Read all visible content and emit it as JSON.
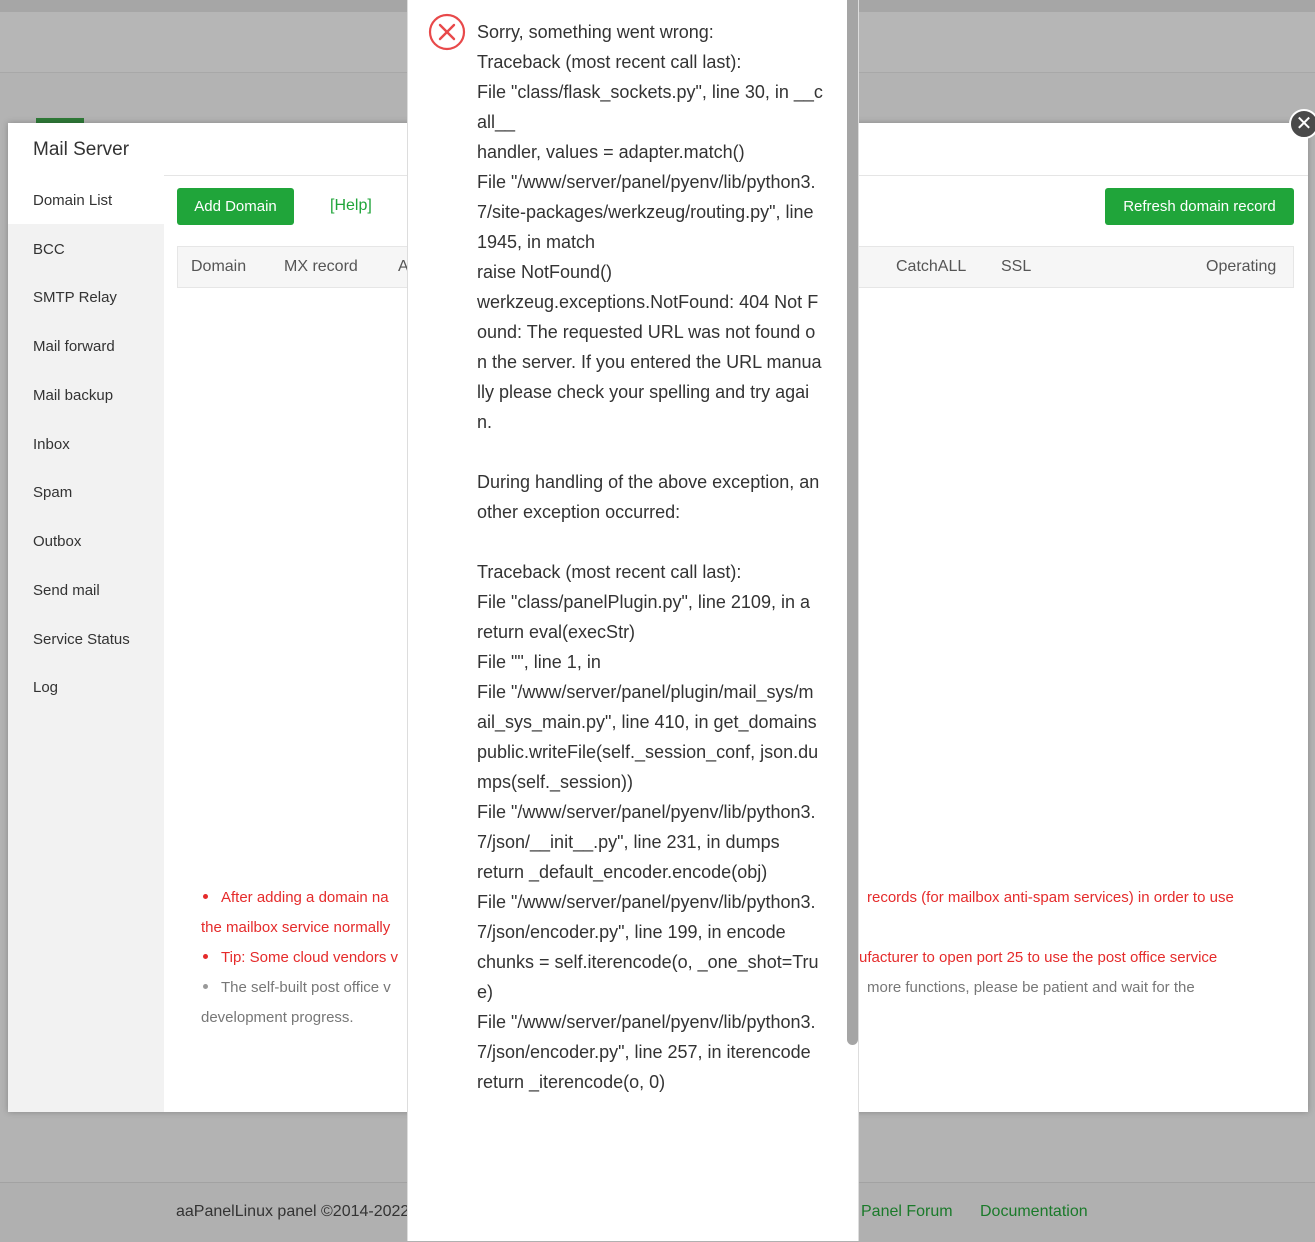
{
  "footer": {
    "copyright": "aaPanelLinux panel ©2014-2022",
    "links": [
      "Panel Forum",
      "Documentation"
    ]
  },
  "modal": {
    "title": "Mail Server",
    "close_glyph": "✕",
    "sidebar": [
      "Domain List",
      "BCC",
      "SMTP Relay",
      "Mail forward",
      "Mail backup",
      "Inbox",
      "Spam",
      "Outbox",
      "Send mail",
      "Service Status",
      "Log"
    ],
    "add_domain_label": "Add Domain",
    "help_label": "[Help]",
    "refresh_label": "Refresh domain record",
    "columns": [
      "Domain",
      "MX record",
      "A",
      "CatchALL",
      "SSL",
      "Operating"
    ],
    "notes": [
      {
        "left": "After adding a domain na",
        "right": "records (for mailbox anti-spam services) in order to use",
        "cont": "the mailbox service normally"
      },
      {
        "left": "Tip: Some cloud vendors v",
        "right": "ufacturer to open port 25 to use the post office service"
      },
      {
        "left": "The self-built post office v",
        "right": "more functions, please be patient and wait for the",
        "cont": "development progress."
      }
    ]
  },
  "error": {
    "icon": "error-x-circle-icon",
    "color": "#e8494a",
    "message": "Sorry, something went wrong:\nTraceback (most recent call last):\nFile \"class/flask_sockets.py\", line 30, in __call__\nhandler, values = adapter.match()\nFile \"/www/server/panel/pyenv/lib/python3.7/site-packages/werkzeug/routing.py\", line 1945, in match\nraise NotFound()\nwerkzeug.exceptions.NotFound: 404 Not Found: The requested URL was not found on the server. If you entered the URL manually please check your spelling and try again.\n\nDuring handling of the above exception, another exception occurred:\n\nTraceback (most recent call last):\nFile \"class/panelPlugin.py\", line 2109, in a\nreturn eval(execStr)\nFile \"\", line 1, in\nFile \"/www/server/panel/plugin/mail_sys/mail_sys_main.py\", line 410, in get_domains\npublic.writeFile(self._session_conf, json.dumps(self._session))\nFile \"/www/server/panel/pyenv/lib/python3.7/json/__init__.py\", line 231, in dumps\nreturn _default_encoder.encode(obj)\nFile \"/www/server/panel/pyenv/lib/python3.7/json/encoder.py\", line 199, in encode\nchunks = self.iterencode(o, _one_shot=True)\nFile \"/www/server/panel/pyenv/lib/python3.7/json/encoder.py\", line 257, in iterencode\nreturn _iterencode(o, 0)"
  }
}
